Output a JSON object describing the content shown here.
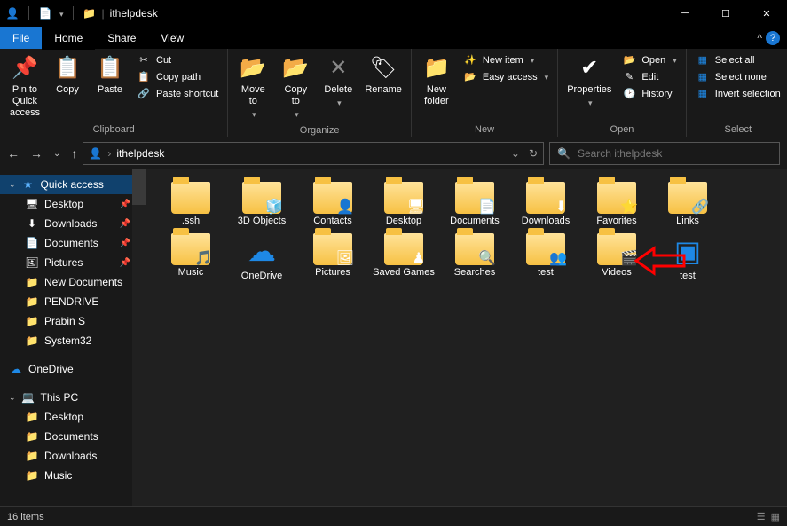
{
  "window": {
    "title": "ithelpdesk"
  },
  "menubar": {
    "file": "File",
    "tabs": [
      "Home",
      "Share",
      "View"
    ],
    "active": 0
  },
  "ribbon": {
    "clipboard": {
      "label": "Clipboard",
      "pin": "Pin to Quick\naccess",
      "copy": "Copy",
      "paste": "Paste",
      "cut": "Cut",
      "copy_path": "Copy path",
      "paste_shortcut": "Paste shortcut"
    },
    "organize": {
      "label": "Organize",
      "move_to": "Move\nto",
      "copy_to": "Copy\nto",
      "delete": "Delete",
      "rename": "Rename"
    },
    "new": {
      "label": "New",
      "new_folder": "New\nfolder",
      "new_item": "New item",
      "easy_access": "Easy access"
    },
    "open": {
      "label": "Open",
      "properties": "Properties",
      "open": "Open",
      "edit": "Edit",
      "history": "History"
    },
    "select": {
      "label": "Select",
      "select_all": "Select all",
      "select_none": "Select none",
      "invert": "Invert selection"
    }
  },
  "nav": {
    "address": "ithelpdesk",
    "search_placeholder": "Search ithelpdesk"
  },
  "sidebar": {
    "quick_access": "Quick access",
    "items": [
      {
        "label": "Desktop",
        "pinned": true,
        "icon": "🖥"
      },
      {
        "label": "Downloads",
        "pinned": true,
        "icon": "⬇"
      },
      {
        "label": "Documents",
        "pinned": true,
        "icon": "📄"
      },
      {
        "label": "Pictures",
        "pinned": true,
        "icon": "🖼"
      },
      {
        "label": "New Documents",
        "pinned": false,
        "icon": "📁"
      },
      {
        "label": "PENDRIVE",
        "pinned": false,
        "icon": "📁"
      },
      {
        "label": "Prabin S",
        "pinned": false,
        "icon": "📁"
      },
      {
        "label": "System32",
        "pinned": false,
        "icon": "📁"
      }
    ],
    "onedrive": "OneDrive",
    "thispc": "This PC",
    "pc_items": [
      {
        "label": "Desktop"
      },
      {
        "label": "Documents"
      },
      {
        "label": "Downloads"
      },
      {
        "label": "Music"
      }
    ]
  },
  "items": [
    {
      "label": ".ssh",
      "type": "folder"
    },
    {
      "label": "3D Objects",
      "type": "folder",
      "overlay": "🧊"
    },
    {
      "label": "Contacts",
      "type": "folder",
      "overlay": "👤"
    },
    {
      "label": "Desktop",
      "type": "folder",
      "overlay": "🖥"
    },
    {
      "label": "Documents",
      "type": "folder",
      "overlay": "📄"
    },
    {
      "label": "Downloads",
      "type": "folder",
      "overlay": "⬇"
    },
    {
      "label": "Favorites",
      "type": "folder",
      "overlay": "⭐"
    },
    {
      "label": "Links",
      "type": "folder",
      "overlay": "🔗"
    },
    {
      "label": "Music",
      "type": "folder",
      "overlay": "🎵"
    },
    {
      "label": "OneDrive",
      "type": "cloud"
    },
    {
      "label": "Pictures",
      "type": "folder",
      "overlay": "🖼"
    },
    {
      "label": "Saved Games",
      "type": "folder",
      "overlay": "♟"
    },
    {
      "label": "Searches",
      "type": "folder",
      "overlay": "🔍"
    },
    {
      "label": "test",
      "type": "folder",
      "overlay": "👥"
    },
    {
      "label": "Videos",
      "type": "folder",
      "overlay": "🎬"
    },
    {
      "label": "test",
      "type": "registry"
    }
  ],
  "status": {
    "count": "16 items"
  }
}
